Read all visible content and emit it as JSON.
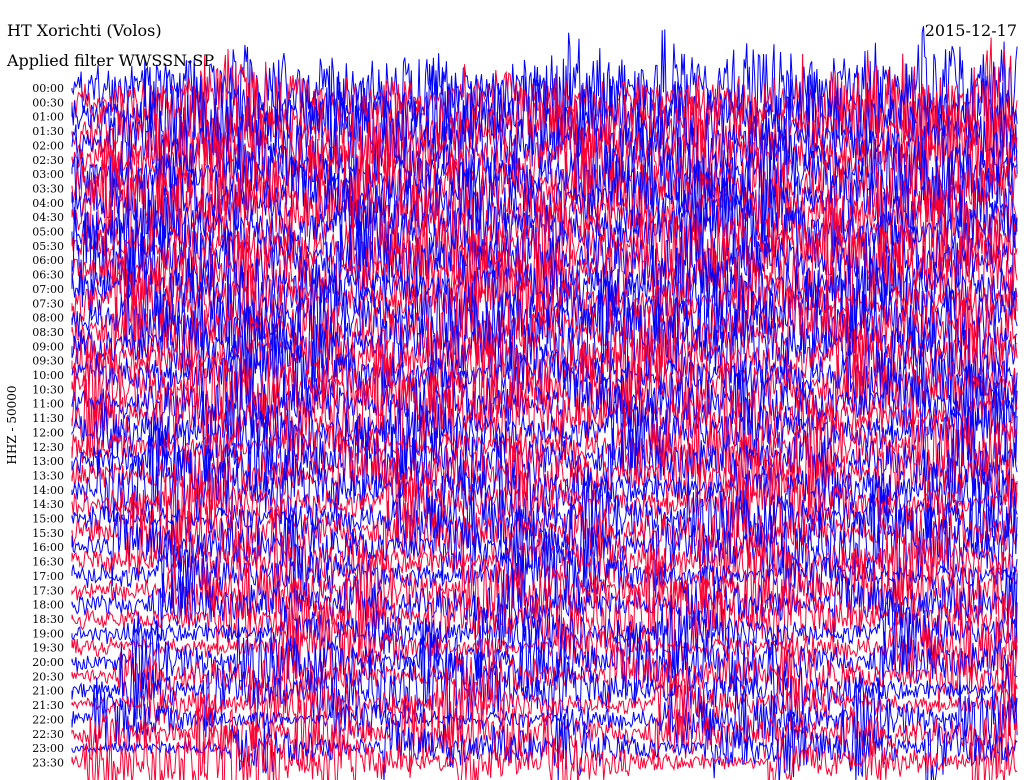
{
  "chart_data": {
    "type": "line",
    "title": "HT Xorichti (Volos)",
    "subtitle": "Applied filter WWSSN-SP",
    "date": "2015-12-17",
    "ylabel": "HHZ - 50000",
    "xlabel": "",
    "row_labels": [
      "00:00",
      "00:30",
      "01:00",
      "01:30",
      "02:00",
      "02:30",
      "03:00",
      "03:30",
      "04:00",
      "04:30",
      "05:00",
      "05:30",
      "06:00",
      "06:30",
      "07:00",
      "07:30",
      "08:00",
      "08:30",
      "09:00",
      "09:30",
      "10:00",
      "10:30",
      "11:00",
      "11:30",
      "12:00",
      "12:30",
      "13:00",
      "13:30",
      "14:00",
      "14:30",
      "15:00",
      "15:30",
      "16:00",
      "16:30",
      "17:00",
      "17:30",
      "18:00",
      "18:30",
      "19:00",
      "19:30",
      "20:00",
      "20:30",
      "21:00",
      "21:30",
      "22:00",
      "22:30",
      "23:00",
      "23:30"
    ],
    "trace_colors": [
      "#0000ff",
      "#ff0033"
    ],
    "grid": false,
    "legend": "none"
  }
}
